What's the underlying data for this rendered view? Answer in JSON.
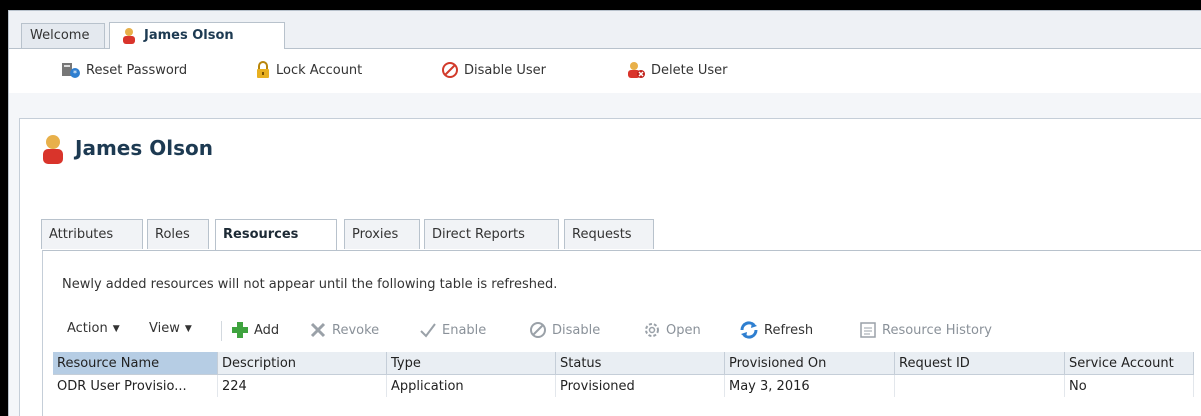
{
  "top_tabs": [
    {
      "label": "Welcome"
    },
    {
      "label": "James Olson"
    }
  ],
  "toolbar": {
    "reset_password": "Reset Password",
    "lock_account": "Lock Account",
    "disable_user": "Disable User",
    "delete_user": "Delete User"
  },
  "user": {
    "name": "James Olson"
  },
  "sub_tabs": [
    {
      "label": "Attributes"
    },
    {
      "label": "Roles"
    },
    {
      "label": "Resources"
    },
    {
      "label": "Proxies"
    },
    {
      "label": "Direct Reports"
    },
    {
      "label": "Requests"
    }
  ],
  "notice": "Newly added resources will not appear until the following table is refreshed.",
  "table_toolbar": {
    "action": "Action",
    "view": "View",
    "add": "Add",
    "revoke": "Revoke",
    "enable": "Enable",
    "disable": "Disable",
    "open": "Open",
    "refresh": "Refresh",
    "resource_history": "Resource History"
  },
  "table": {
    "headers": [
      "Resource Name",
      "Description",
      "Type",
      "Status",
      "Provisioned On",
      "Request ID",
      "Service Account"
    ],
    "rows": [
      [
        "ODR User Provisio...",
        "224",
        "Application",
        "Provisioned",
        "May 3, 2016",
        "",
        "No"
      ]
    ]
  },
  "colors": {
    "accent": "#1d3a52",
    "add_green": "#3fa33f",
    "disable_red": "#d23b2b",
    "selected_header": "#b6cde4"
  }
}
